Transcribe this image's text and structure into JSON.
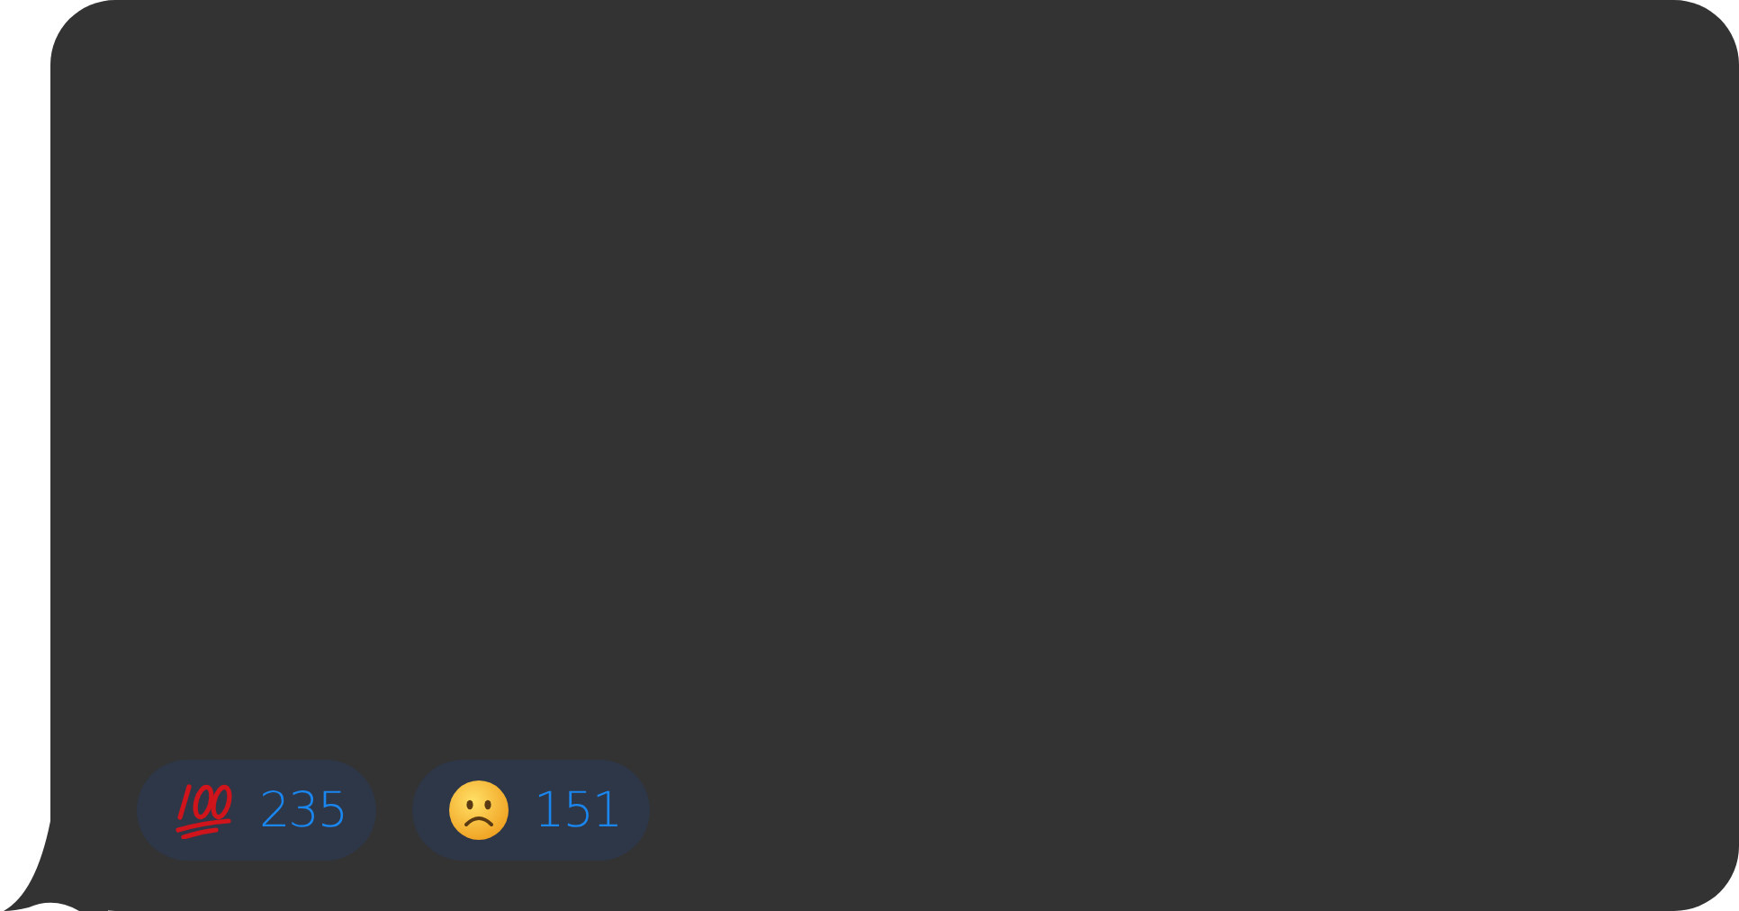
{
  "message": {
    "reactions": [
      {
        "kind": "hundred",
        "count": "235"
      },
      {
        "kind": "frown",
        "count": "151"
      }
    ]
  }
}
